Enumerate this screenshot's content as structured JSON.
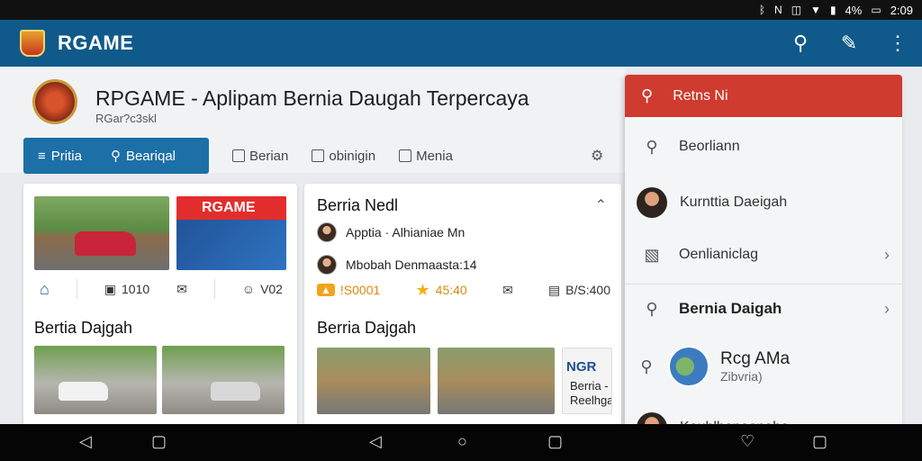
{
  "status_bar": {
    "icons": [
      "bluetooth-icon",
      "nfc-icon",
      "vibrate-icon",
      "wifi-icon",
      "data-icon"
    ],
    "battery": "4%",
    "time": "2:09"
  },
  "app_bar": {
    "title": "RGAME",
    "actions": [
      "search-icon",
      "chat-icon",
      "more-vert-icon"
    ]
  },
  "header": {
    "title": "RPGAME - Aplipam Bernia Daugah Terpercaya",
    "subtitle": "RGar?c3skl"
  },
  "tabs": {
    "active": [
      {
        "icon": "≡",
        "label": "Pritia"
      },
      {
        "icon": "⚲",
        "label": "Beariqal"
      }
    ],
    "items": [
      {
        "label": "Berian"
      },
      {
        "label": "obinigin"
      },
      {
        "label": "Menia"
      }
    ]
  },
  "card1": {
    "banner": "RGAME",
    "stats": [
      "1010",
      "V02"
    ],
    "section_title": "Bertia Dajgah"
  },
  "card2": {
    "title": "Berria Nedl",
    "people": [
      {
        "name": "Apptia · Alhianiae Mn"
      },
      {
        "name": "Mbobah Denmaasta:14"
      }
    ],
    "stats": [
      "!S0001",
      "45:40",
      "B/S:400"
    ],
    "section_title": "Berria Dajgah",
    "sign_title": "NGR",
    "sign_text_1": "Berria -",
    "sign_text_2": "Reelhga"
  },
  "panel": {
    "header": "Retns Ni",
    "items": [
      {
        "label": "Beorliann"
      },
      {
        "label": "Kurnttia Daeigah"
      },
      {
        "label": "Oenlianiclag"
      },
      {
        "label": "Bernia Daigah"
      },
      {
        "label": "Rcg AMa",
        "sub": "Zibvria)"
      },
      {
        "label": "Kouhlhanoonaha"
      }
    ]
  },
  "nav_bar": [
    "back-icon",
    "recents-icon",
    "back-icon",
    "home-icon",
    "recents-icon",
    "heart-icon",
    "recents-icon"
  ],
  "colors": {
    "app_bar": "#0f5a8a",
    "tab_active": "#1d6fa8",
    "panel_header": "#cf3b2f"
  }
}
